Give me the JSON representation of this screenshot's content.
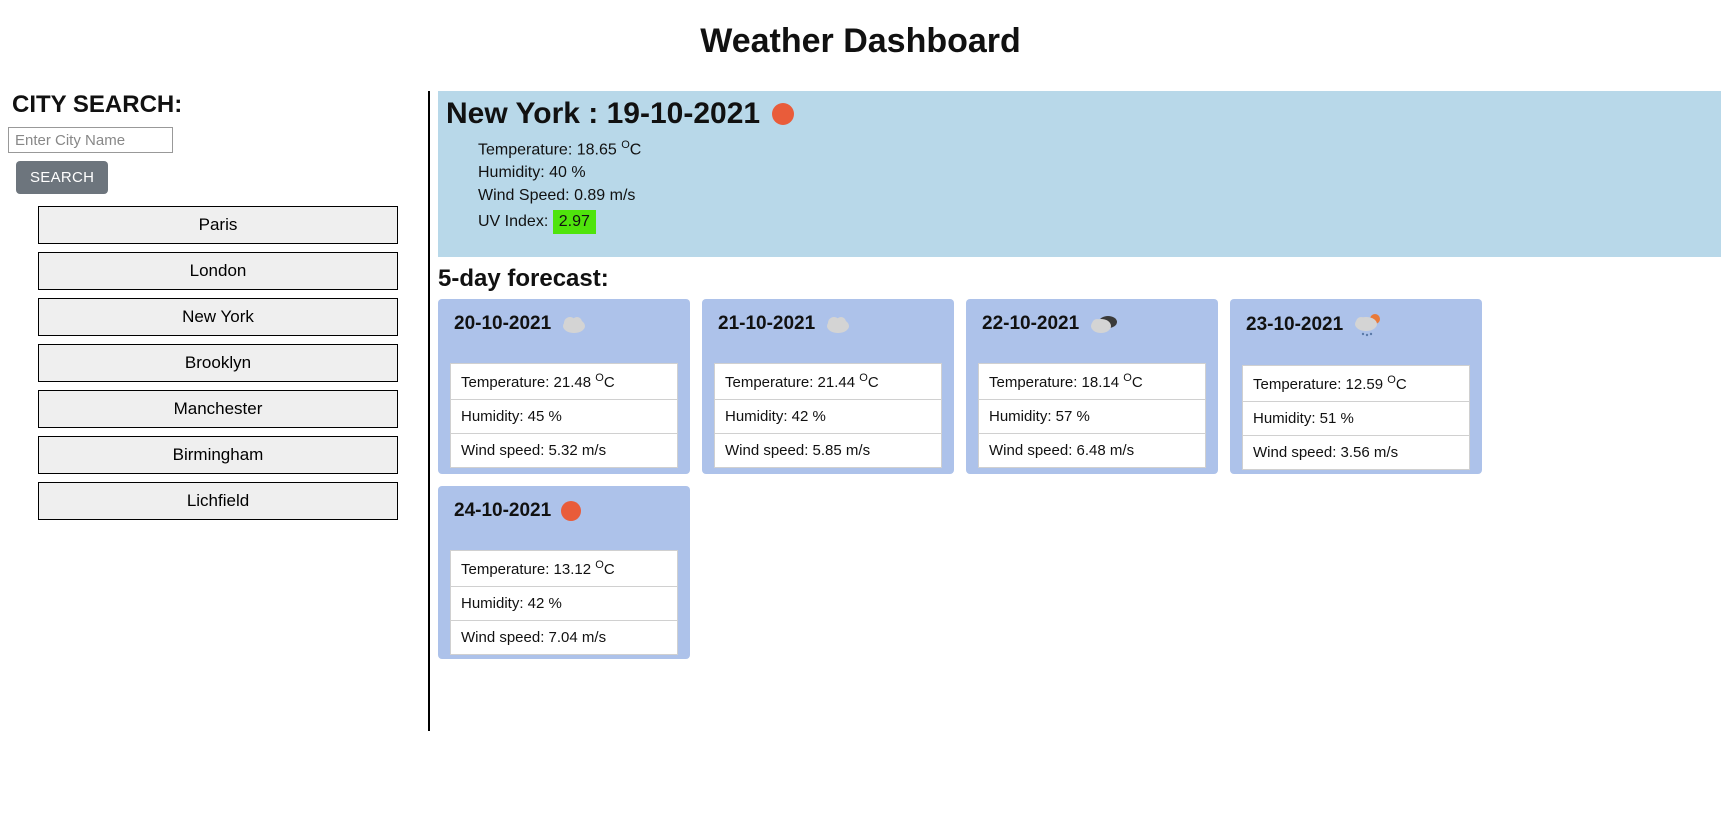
{
  "title": "Weather Dashboard",
  "search": {
    "label": "CITY SEARCH:",
    "placeholder": "Enter City Name",
    "button": "SEARCH"
  },
  "history": [
    "Paris",
    "London",
    "New York",
    "Brooklyn",
    "Manchester",
    "Birmingham",
    "Lichfield"
  ],
  "current": {
    "city": "New York",
    "date": "19-10-2021",
    "icon": "sun",
    "tempLabel": "Temperature:",
    "temp": "18.65",
    "tempUnit": "C",
    "humidityLabel": "Humidity:",
    "humidity": "40 %",
    "windLabel": "Wind Speed:",
    "wind": "0.89 m/s",
    "uvLabel": "UV Index:",
    "uv": "2.97",
    "uvColor": "#4fe40c"
  },
  "forecastTitle": "5-day forecast:",
  "labels": {
    "temp": "Temperature:",
    "humidity": "Humidity:",
    "wind": "Wind speed:"
  },
  "forecast": [
    {
      "date": "20-10-2021",
      "icon": "cloud",
      "temp": "21.48",
      "humidity": "45 %",
      "wind": "5.32 m/s"
    },
    {
      "date": "21-10-2021",
      "icon": "cloud",
      "temp": "21.44",
      "humidity": "42 %",
      "wind": "5.85 m/s"
    },
    {
      "date": "22-10-2021",
      "icon": "darkcloud",
      "temp": "18.14",
      "humidity": "57 %",
      "wind": "6.48 m/s"
    },
    {
      "date": "23-10-2021",
      "icon": "rain",
      "temp": "12.59",
      "humidity": "51 %",
      "wind": "3.56 m/s"
    },
    {
      "date": "24-10-2021",
      "icon": "sun",
      "temp": "13.12",
      "humidity": "42 %",
      "wind": "7.04 m/s"
    }
  ]
}
